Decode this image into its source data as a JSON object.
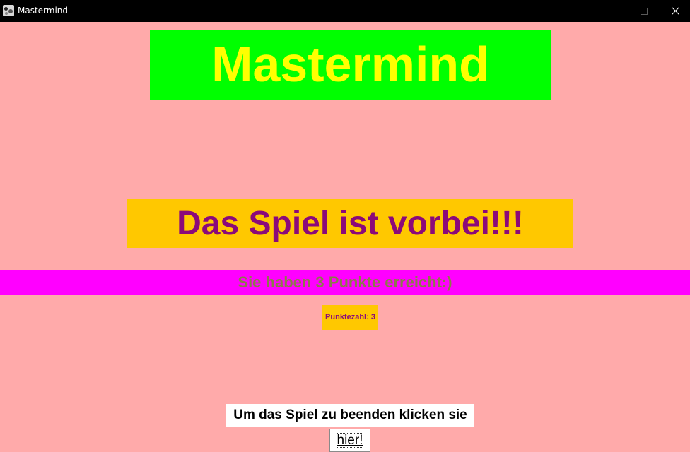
{
  "window": {
    "title": "Mastermind",
    "icon": "app-icon",
    "controls": [
      "minimize-icon",
      "maximize-icon",
      "close-icon"
    ]
  },
  "main": {
    "heading": "Mastermind",
    "game_over": "Das Spiel ist vorbei!!!",
    "score_message": "Sie haben 3 Punkte erreicht:)",
    "points_label": "Punktezahl: 3",
    "end_prompt": "Um das Spiel zu beenden klicken sie",
    "end_button": "hier!"
  },
  "colors": {
    "background": "#ffaaaa",
    "heading_bg": "#00ff00",
    "heading_text": "#ffff00",
    "banner_bg": "#ffc800",
    "banner_text": "#8b0a7a",
    "score_bg": "#ff00ff",
    "score_text": "#8b7a4a"
  }
}
